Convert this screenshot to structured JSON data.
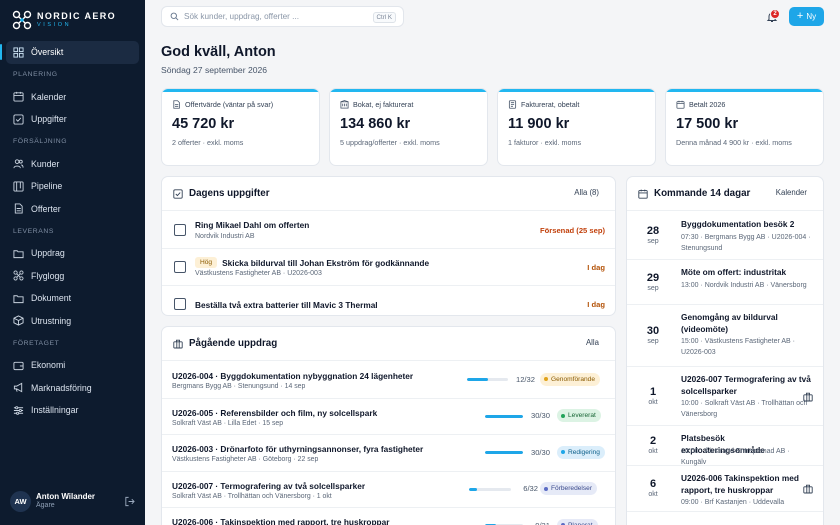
{
  "brand": {
    "name": "NORDIC AERO",
    "sub": "VISION",
    "accent": "#22b7f0",
    "sidebar_bg": "#0d1b2e"
  },
  "nav": {
    "overview": {
      "label": "Översikt",
      "icon": "grid-icon"
    },
    "section_planning": "PLANERING",
    "calendar": {
      "label": "Kalender",
      "icon": "calendar-icon"
    },
    "tasks": {
      "label": "Uppgifter",
      "icon": "checkbox-icon"
    },
    "section_sales": "FÖRSÄLJNING",
    "customers": {
      "label": "Kunder",
      "icon": "users-icon"
    },
    "pipeline": {
      "label": "Pipeline",
      "icon": "pipeline-icon"
    },
    "offers": {
      "label": "Offerter",
      "icon": "document-icon"
    },
    "section_delivery": "LEVERANS",
    "missions": {
      "label": "Uppdrag",
      "icon": "folder-icon"
    },
    "flightlog": {
      "label": "Flyglogg",
      "icon": "drone-icon"
    },
    "documents": {
      "label": "Dokument",
      "icon": "folder-icon"
    },
    "equipment": {
      "label": "Utrustning",
      "icon": "box-icon"
    },
    "section_company": "FÖRETAGET",
    "economy": {
      "label": "Ekonomi",
      "icon": "wallet-icon"
    },
    "marketing": {
      "label": "Marknadsföring",
      "icon": "megaphone-icon"
    },
    "settings": {
      "label": "Inställningar",
      "icon": "sliders-icon"
    }
  },
  "user": {
    "initials": "AW",
    "name": "Anton Wilander",
    "role": "Ägare"
  },
  "topbar": {
    "search_placeholder": "Sök kunder, uppdrag, offerter ...",
    "search_shortcut": "Ctrl K",
    "notification_count": "2",
    "new_label": "Ny"
  },
  "header": {
    "greeting": "God kväll, Anton",
    "date": "Söndag 27 september 2026"
  },
  "stats": [
    {
      "label": "Offertvärde (väntar på svar)",
      "value": "45 720 kr",
      "sub": "2 offerter · exkl. moms",
      "icon": "document-icon"
    },
    {
      "label": "Bokat, ej fakturerat",
      "value": "134 860 kr",
      "sub": "5 uppdrag/offerter · exkl. moms",
      "icon": "building-icon"
    },
    {
      "label": "Fakturerat, obetalt",
      "value": "11 900 kr",
      "sub": "1 fakturor · exkl. moms",
      "icon": "invoice-icon"
    },
    {
      "label": "Betalt 2026",
      "value": "17 500 kr",
      "sub": "Denna månad 4 900 kr · exkl. moms",
      "icon": "calendar-icon"
    }
  ],
  "tasks_card": {
    "title": "Dagens uppgifter",
    "link": "Alla (8)",
    "items": [
      {
        "title": "Ring Mikael Dahl om offerten",
        "sub": "Nordvik Industri AB",
        "status": "Försenad (25 sep)",
        "status_color": "#c2410c"
      },
      {
        "priority": "Hög",
        "title": "Skicka bildurval till Johan Ekström för godkännande",
        "sub": "Västkustens Fastigheter AB · U2026-003",
        "status": "I dag",
        "status_color": "#b45309"
      },
      {
        "title": "Beställa två extra batterier till Mavic 3 Thermal",
        "status": "I dag",
        "status_color": "#b45309"
      }
    ]
  },
  "missions_card": {
    "title": "Pågående uppdrag",
    "link": "Alla",
    "items": [
      {
        "title": "U2026-004 · Byggdokumentation nybyggnation 24 lägenheter",
        "sub": "Bergmans Bygg AB · Stenungsund · 14 sep",
        "progress": 0.5,
        "count": "12/32",
        "status": "Genomförande",
        "pill_bg": "#fdf0d6",
        "pill_color": "#8a5a00",
        "dot": "#e0a21a"
      },
      {
        "title": "U2026-005 · Referensbilder och film, ny solcellspark",
        "sub": "Solkraft Väst AB · Lilla Edet · 15 sep",
        "progress": 1.0,
        "count": "30/30",
        "status": "Levererat",
        "pill_bg": "#dcf3e4",
        "pill_color": "#166534",
        "dot": "#22a35a"
      },
      {
        "title": "U2026-003 · Drönarfoto för uthyrningsannonser, fyra fastigheter",
        "sub": "Västkustens Fastigheter AB · Göteborg · 22 sep",
        "progress": 1.0,
        "count": "30/30",
        "status": "Redigering",
        "pill_bg": "#dbeefb",
        "pill_color": "#0b5f8a",
        "dot": "#1ea6e8"
      },
      {
        "title": "U2026-007 · Termografering av två solcellsparker",
        "sub": "Solkraft Väst AB · Trollhättan och Vänersborg · 1 okt",
        "progress": 0.18,
        "count": "6/32",
        "status": "Förberedelser",
        "pill_bg": "#e6eaf7",
        "pill_color": "#3b4a8c",
        "dot": "#5b6cc4"
      },
      {
        "title": "U2026-006 · Takinspektion med rapport, tre huskroppar",
        "sub": "",
        "progress": 0.3,
        "count": "9/31",
        "status": "Planerat",
        "pill_bg": "#e6eaf7",
        "pill_color": "#3b4a8c",
        "dot": "#5b6cc4"
      }
    ]
  },
  "upcoming_card": {
    "title": "Kommande 14 dagar",
    "link": "Kalender",
    "items": [
      {
        "day": "28",
        "month": "sep",
        "title": "Byggdokumentation besök 2",
        "sub": "07:30 · Bergmans Bygg AB · U2026-004 · Stenungsund"
      },
      {
        "day": "29",
        "month": "sep",
        "title": "Möte om offert: industritak",
        "sub": "13:00 · Nordvik Industri AB · Vänersborg"
      },
      {
        "day": "30",
        "month": "sep",
        "title": "Genomgång av bildurval (videomöte)",
        "sub": "15:00 · Västkustens Fastigheter AB · U2026-003"
      },
      {
        "day": "1",
        "month": "okt",
        "title": "U2026-007 Termografering av två solcellsparker",
        "sub": "10:00 · Solkraft Väst AB · Trollhättan och Vänersborg",
        "icon": "briefcase-icon"
      },
      {
        "day": "2",
        "month": "okt",
        "title": "Platsbesök exploateringsområde",
        "sub": "10:00 · Älvstrand Entreprenad AB · Kungälv"
      },
      {
        "day": "6",
        "month": "okt",
        "title": "U2026-006 Takinspektion med rapport, tre huskroppar",
        "sub": "09:00 · Brf Kastanjen · Uddevalla",
        "icon": "briefcase-icon"
      }
    ]
  }
}
